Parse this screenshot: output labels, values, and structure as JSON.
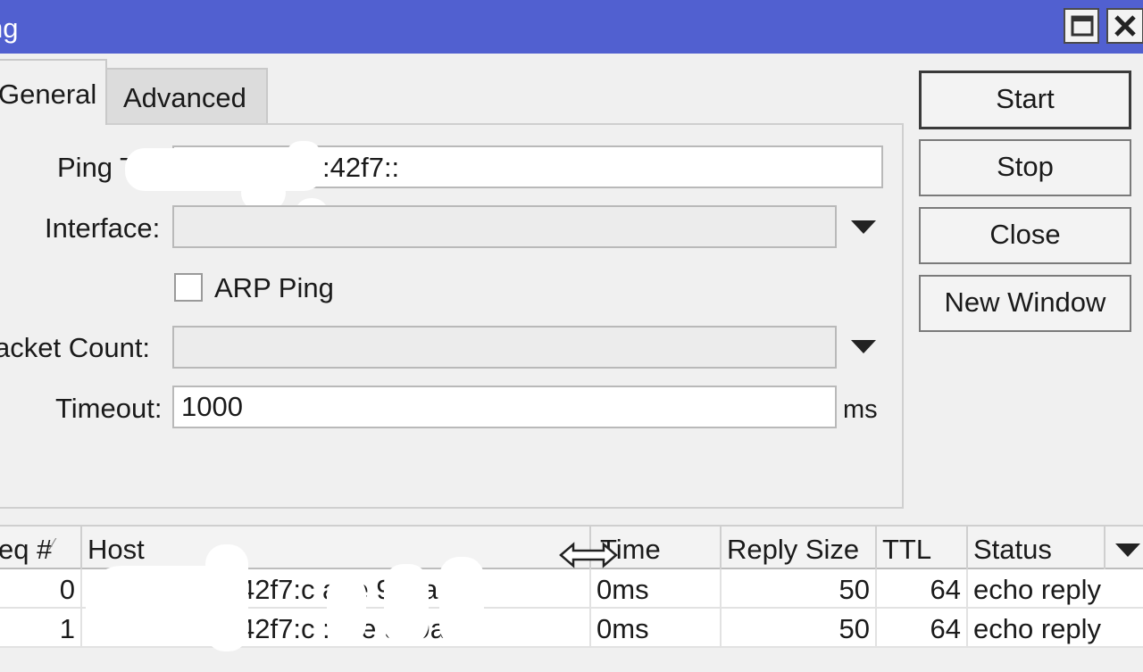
{
  "window": {
    "title": "ng"
  },
  "tabs": [
    {
      "label": "General"
    },
    {
      "label": "Advanced"
    }
  ],
  "form": {
    "ping_to_label": "Ping T",
    "ping_to_value": ":42f7::",
    "interface_label": "Interface:",
    "interface_value": "",
    "arp_ping_label": "ARP Ping",
    "packet_count_label": "acket Count:",
    "packet_count_value": "",
    "timeout_label": "Timeout:",
    "timeout_value": "1000",
    "timeout_unit": "ms"
  },
  "buttons": {
    "start": "Start",
    "stop": "Stop",
    "close": "Close",
    "new_window": "New Window"
  },
  "table": {
    "columns": [
      "eq #",
      "Host",
      "Time",
      "Reply Size",
      "TTL",
      "Status"
    ],
    "rows": [
      {
        "seq": "0",
        "host": "42f7:c   a     fe    9e9a",
        "time": "0ms",
        "reply_size": "50",
        "ttl": "64",
        "status": "echo reply"
      },
      {
        "seq": "1",
        "host": "42f7:c   :a    /e    9e9a",
        "time": "0ms",
        "reply_size": "50",
        "ttl": "64",
        "status": "echo reply"
      }
    ]
  },
  "icons": {
    "maximize": "maximize-icon",
    "close": "close-icon",
    "dropdown": "chevron-down-icon",
    "sort": "sort-icon",
    "resize": "resize-horizontal-icon"
  },
  "colors": {
    "titlebar": "#5160d0",
    "background": "#f0f0f0"
  }
}
